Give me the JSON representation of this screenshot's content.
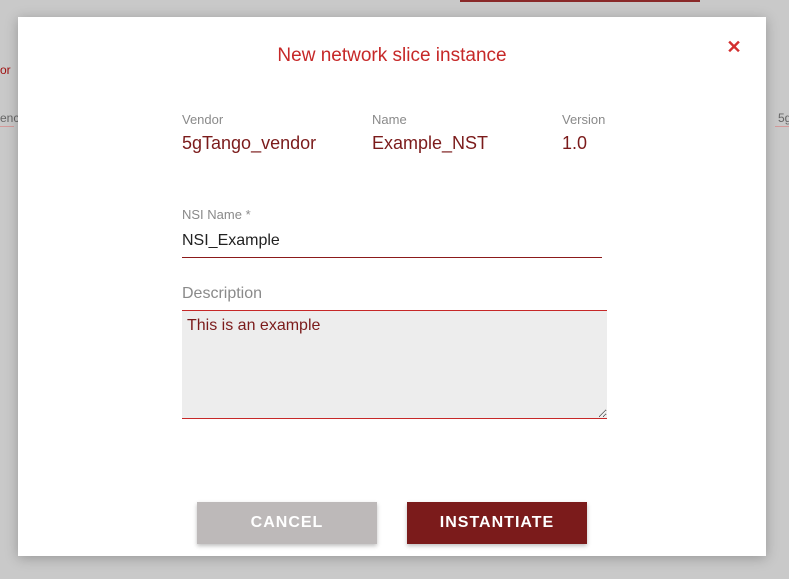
{
  "background": {
    "left_text_1": "or",
    "left_text_2": "enc",
    "right_text": "5g"
  },
  "modal": {
    "title": "New network slice instance",
    "close_symbol": "✕",
    "meta": {
      "vendor_label": "Vendor",
      "vendor_value": "5gTango_vendor",
      "name_label": "Name",
      "name_value": "Example_NST",
      "version_label": "Version",
      "version_value": "1.0"
    },
    "nsi_name": {
      "label": "NSI Name *",
      "value": "NSI_Example"
    },
    "description": {
      "label": "Description",
      "value": "This is an example"
    },
    "buttons": {
      "cancel": "CANCEL",
      "instantiate": "INSTANTIATE"
    }
  },
  "colors": {
    "accent": "#c62828",
    "primary_dark": "#7b1b1b",
    "cancel_button": "#bdb9b9",
    "overlay": "#c9c9c9"
  }
}
